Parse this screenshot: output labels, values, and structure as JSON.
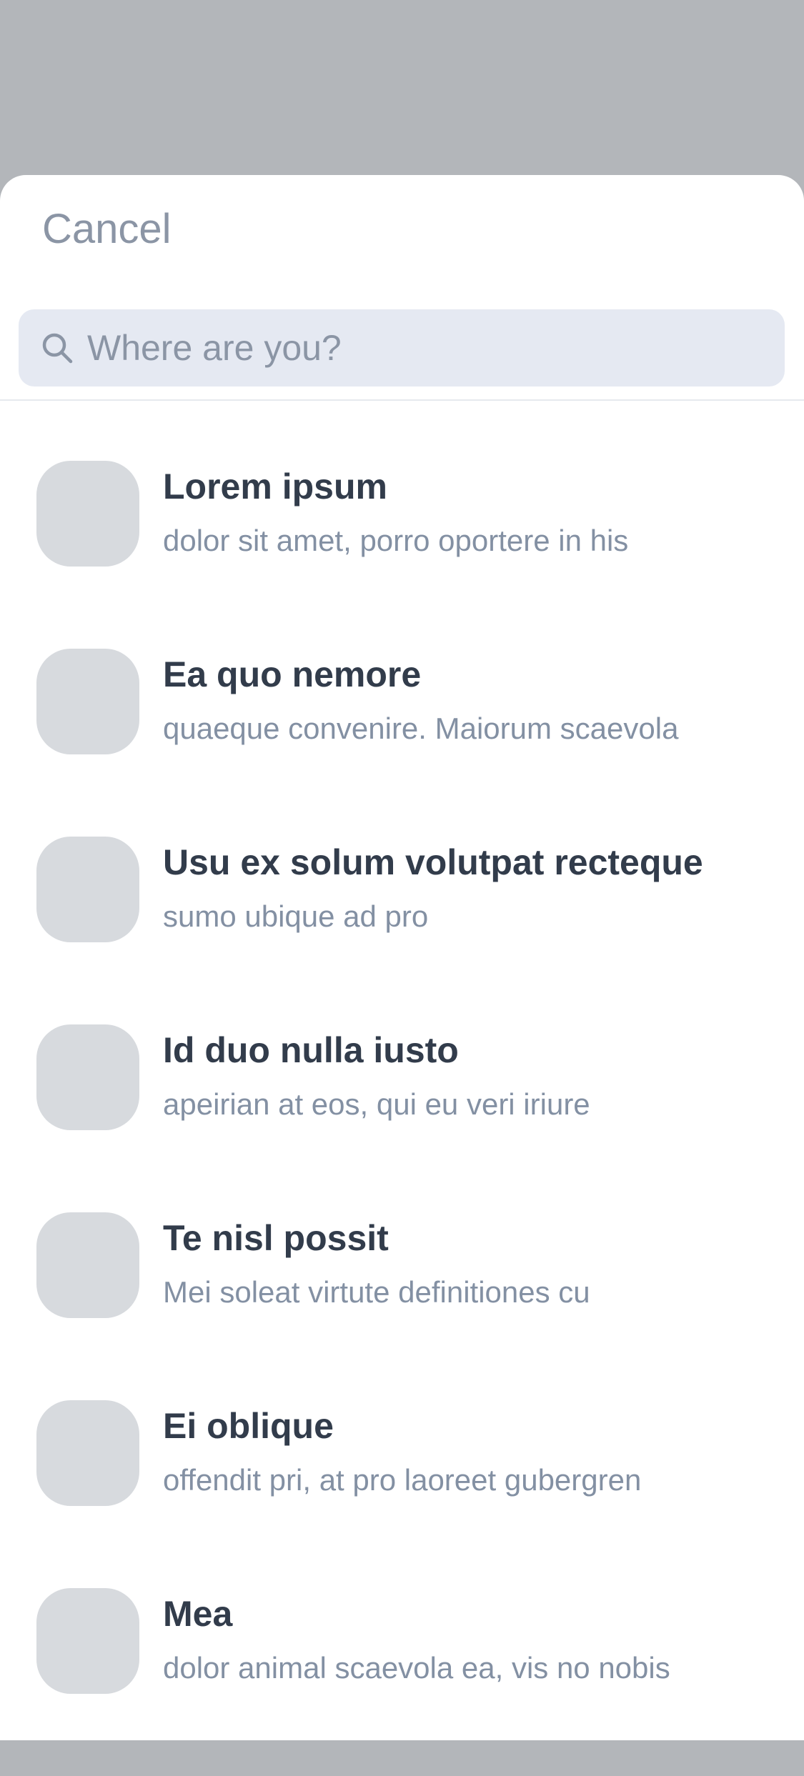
{
  "header": {
    "cancel_label": "Cancel"
  },
  "search": {
    "placeholder": "Where are you?",
    "icon": "search-icon"
  },
  "colors": {
    "backdrop": "#b3b6ba",
    "sheet": "#ffffff",
    "search_bg": "#e5e9f2",
    "title_text": "#323c4b",
    "muted_text": "#8b95a5",
    "thumb": "#d7dade"
  },
  "results": [
    {
      "title": "Lorem ipsum",
      "subtitle": "dolor sit amet, porro oportere in his"
    },
    {
      "title": "Ea quo nemore",
      "subtitle": "quaeque convenire. Maiorum scaevola"
    },
    {
      "title": "Usu ex solum volutpat recteque",
      "subtitle": "sumo ubique ad pro"
    },
    {
      "title": "Id duo nulla iusto",
      "subtitle": "apeirian at eos, qui eu veri iriure"
    },
    {
      "title": "Te nisl possit",
      "subtitle": "Mei soleat virtute definitiones cu"
    },
    {
      "title": "Ei oblique",
      "subtitle": "offendit pri, at pro laoreet gubergren"
    },
    {
      "title": "Mea",
      "subtitle": "dolor animal scaevola ea, vis no nobis"
    }
  ]
}
